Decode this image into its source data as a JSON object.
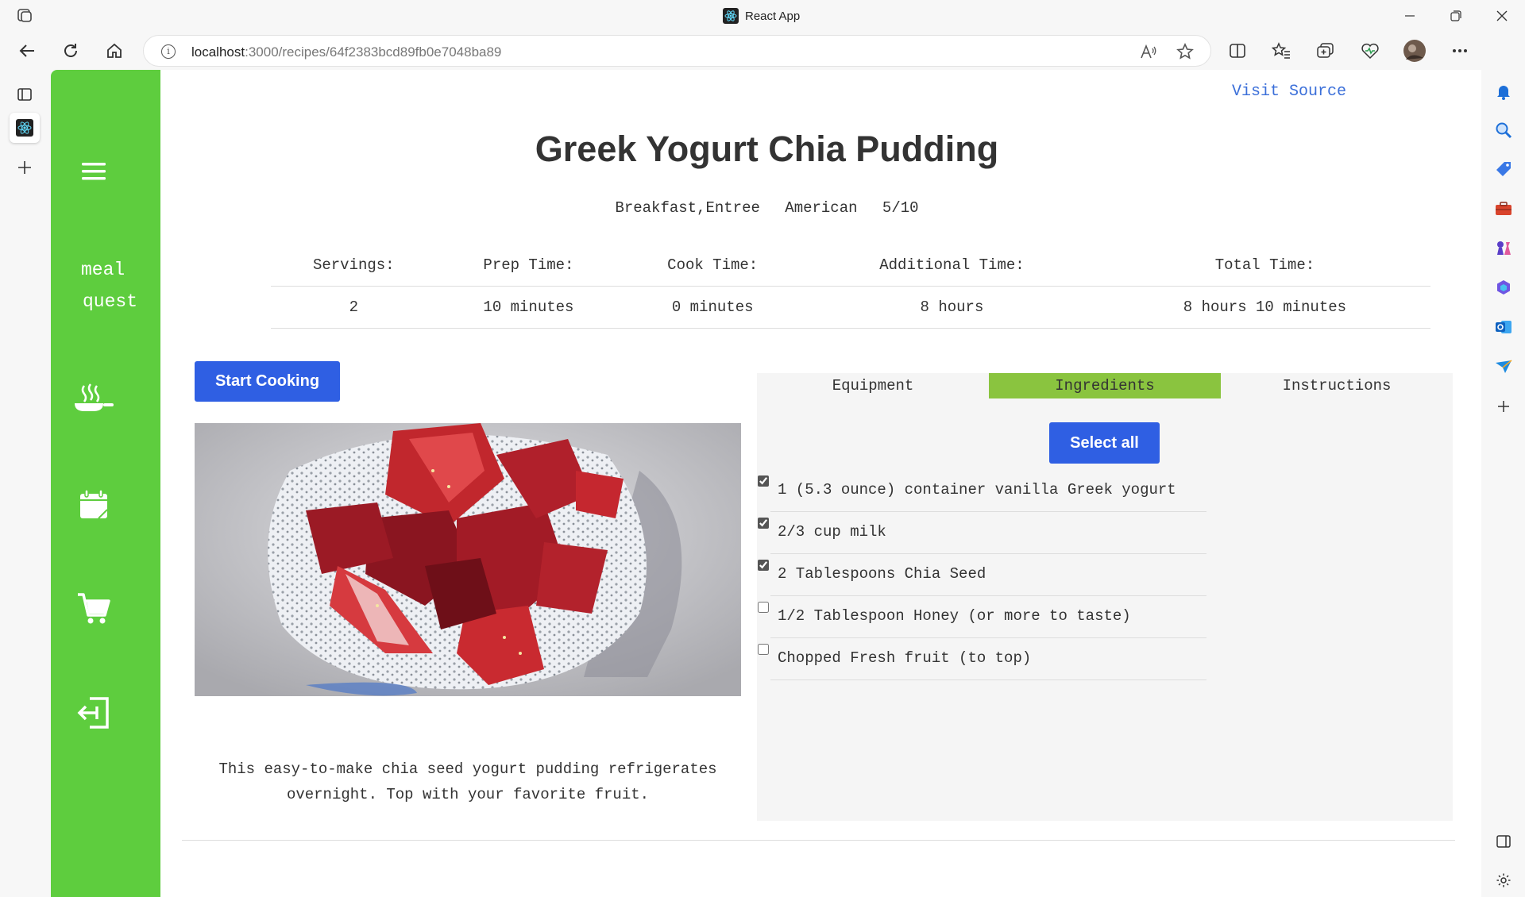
{
  "browser": {
    "tab_title": "React App",
    "url_host": "localhost",
    "url_path": ":3000/recipes/64f2383bcd89fb0e7048ba89"
  },
  "nav": {
    "brand_line1": "meal",
    "brand_line2": "quest"
  },
  "page": {
    "visit_source": "Visit Source",
    "title": "Greek Yogurt Chia Pudding",
    "category": "Breakfast,Entree",
    "cuisine": "American",
    "rating": "5/10",
    "times": {
      "headers": [
        "Servings:",
        "Prep Time:",
        "Cook Time:",
        "Additional Time:",
        "Total Time:"
      ],
      "values": [
        "2",
        "10 minutes",
        "0 minutes",
        "8 hours",
        "8 hours 10 minutes"
      ]
    },
    "start_cooking": "Start Cooking",
    "description": "This easy-to-make chia seed yogurt pudding refrigerates overnight. Top with your favorite fruit."
  },
  "panel": {
    "tabs": [
      "Equipment",
      "Ingredients",
      "Instructions"
    ],
    "active_tab": "Ingredients",
    "select_all": "Select all",
    "ingredients": [
      {
        "text": "1 (5.3 ounce) container vanilla Greek yogurt",
        "checked": true
      },
      {
        "text": "2/3 cup milk",
        "checked": true
      },
      {
        "text": "2 Tablespoons Chia Seed",
        "checked": true
      },
      {
        "text": "1/2 Tablespoon Honey (or more to taste)",
        "checked": false
      },
      {
        "text": "Chopped Fresh fruit (to top)",
        "checked": false
      }
    ]
  },
  "colors": {
    "nav_green": "#5ecd3e",
    "tab_active": "#8ac43f",
    "button_blue": "#2f5fe3",
    "link_blue": "#3b6fd9"
  }
}
